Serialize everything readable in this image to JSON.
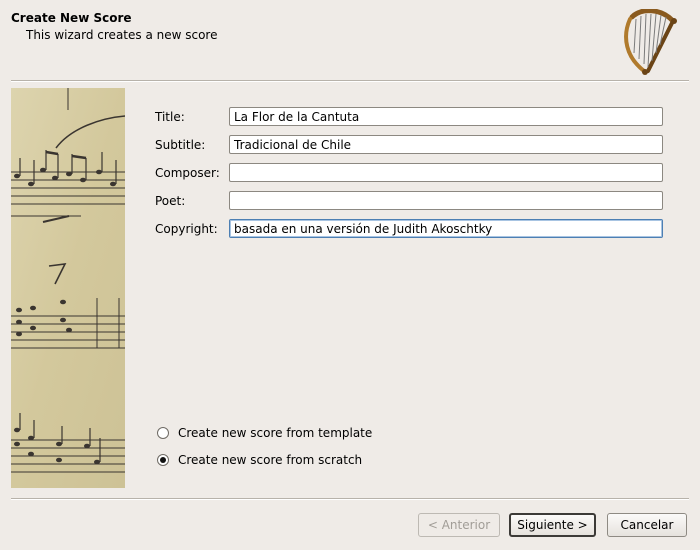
{
  "header": {
    "title": "Create New Score",
    "subtitle": "This wizard creates a new score",
    "logo_icon": "harp-icon"
  },
  "side_image": {
    "icon": "sheet-music-image"
  },
  "form": {
    "title_label": "Title:",
    "title_value": "La Flor de la Cantuta",
    "subtitle_label": "Subtitle:",
    "subtitle_value": "Tradicional de Chile",
    "composer_label": "Composer:",
    "composer_value": "",
    "poet_label": "Poet:",
    "poet_value": "",
    "copyright_label": "Copyright:",
    "copyright_value": "basada en una versión de  Judith Akoschtky"
  },
  "options": {
    "template_label": "Create new score from template",
    "template_checked": false,
    "scratch_label": "Create new score from scratch",
    "scratch_checked": true
  },
  "buttons": {
    "back_label": "< Anterior",
    "next_label": "Siguiente >",
    "cancel_label": "Cancelar"
  },
  "colors": {
    "window_bg": "#efebe7",
    "parchment": "#d8cfa8",
    "ink": "#3a3530"
  }
}
